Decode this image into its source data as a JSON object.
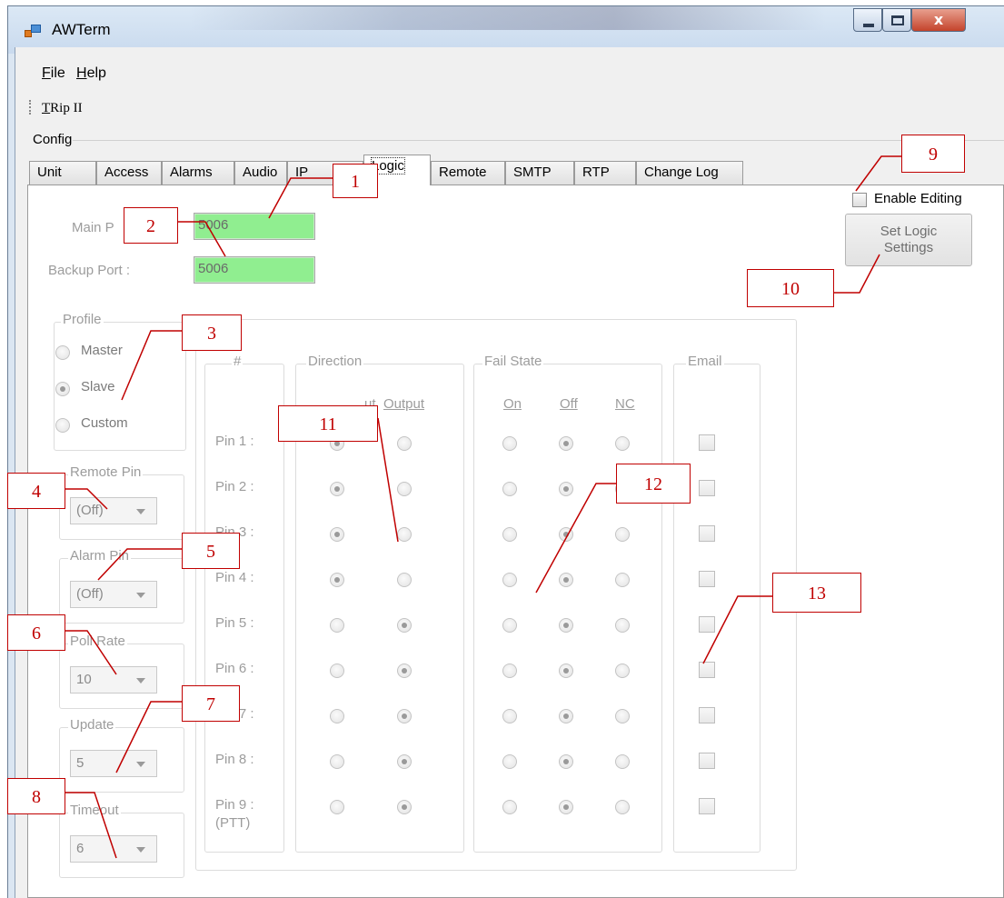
{
  "window": {
    "title": "AWTerm",
    "close_glyph": "x"
  },
  "menu": {
    "file": "File",
    "help": "Help"
  },
  "toolbar": {
    "device": "TRip II"
  },
  "config": {
    "label": "Config"
  },
  "tabs": [
    "Unit",
    "Access",
    "Alarms",
    "Audio",
    "IP",
    "Logic",
    "Remote",
    "SMTP",
    "RTP",
    "Change Log"
  ],
  "active_tab": "Logic",
  "ports": {
    "main_label": "Main P",
    "main_value": "5006",
    "backup_label": "Backup Port :",
    "backup_value": "5006",
    "field_color": "#90ee90"
  },
  "profile": {
    "legend": "Profile",
    "options": [
      "Master",
      "Slave",
      "Custom"
    ],
    "selected": "Slave"
  },
  "remote_pin": {
    "legend": "Remote Pin",
    "value": "(Off)"
  },
  "alarm_pin": {
    "legend": "Alarm Pin",
    "value": "(Off)"
  },
  "poll_rate": {
    "legend": "Poll Rate",
    "value": "10"
  },
  "update": {
    "legend": "Update",
    "value": "5"
  },
  "timeout": {
    "legend": "Timeout",
    "value": "6"
  },
  "pin_table": {
    "hash_legend": "#",
    "direction_legend": "Direction",
    "direction_cols": [
      "Input",
      "Output"
    ],
    "direction_input_visible": "ut",
    "failstate_legend": "Fail State",
    "failstate_cols": [
      "On",
      "Off",
      "NC"
    ],
    "email_legend": "Email",
    "pins": [
      {
        "label": "Pin 1 :",
        "direction": "input"
      },
      {
        "label": "Pin 2 :",
        "direction": "input"
      },
      {
        "label": "Pin 3 :",
        "direction": "input"
      },
      {
        "label": "Pin 4 :",
        "direction": "input"
      },
      {
        "label": "Pin 5 :",
        "direction": "output"
      },
      {
        "label": "Pin 6 :",
        "direction": "output"
      },
      {
        "label": "Pin 7 :",
        "direction": "output"
      },
      {
        "label": "Pin 8 :",
        "direction": "output"
      },
      {
        "label": "Pin 9 :",
        "sublabel": "(PTT)",
        "direction": "output"
      }
    ],
    "failstate_all": "Off"
  },
  "enable_editing": {
    "label": "Enable Editing",
    "checked": false
  },
  "set_logic_button": {
    "line1": "Set Logic",
    "line2": "Settings"
  },
  "callouts": [
    "1",
    "2",
    "3",
    "4",
    "5",
    "6",
    "7",
    "8",
    "9",
    "10",
    "11",
    "12",
    "13"
  ],
  "annotation_color": "#c00000"
}
